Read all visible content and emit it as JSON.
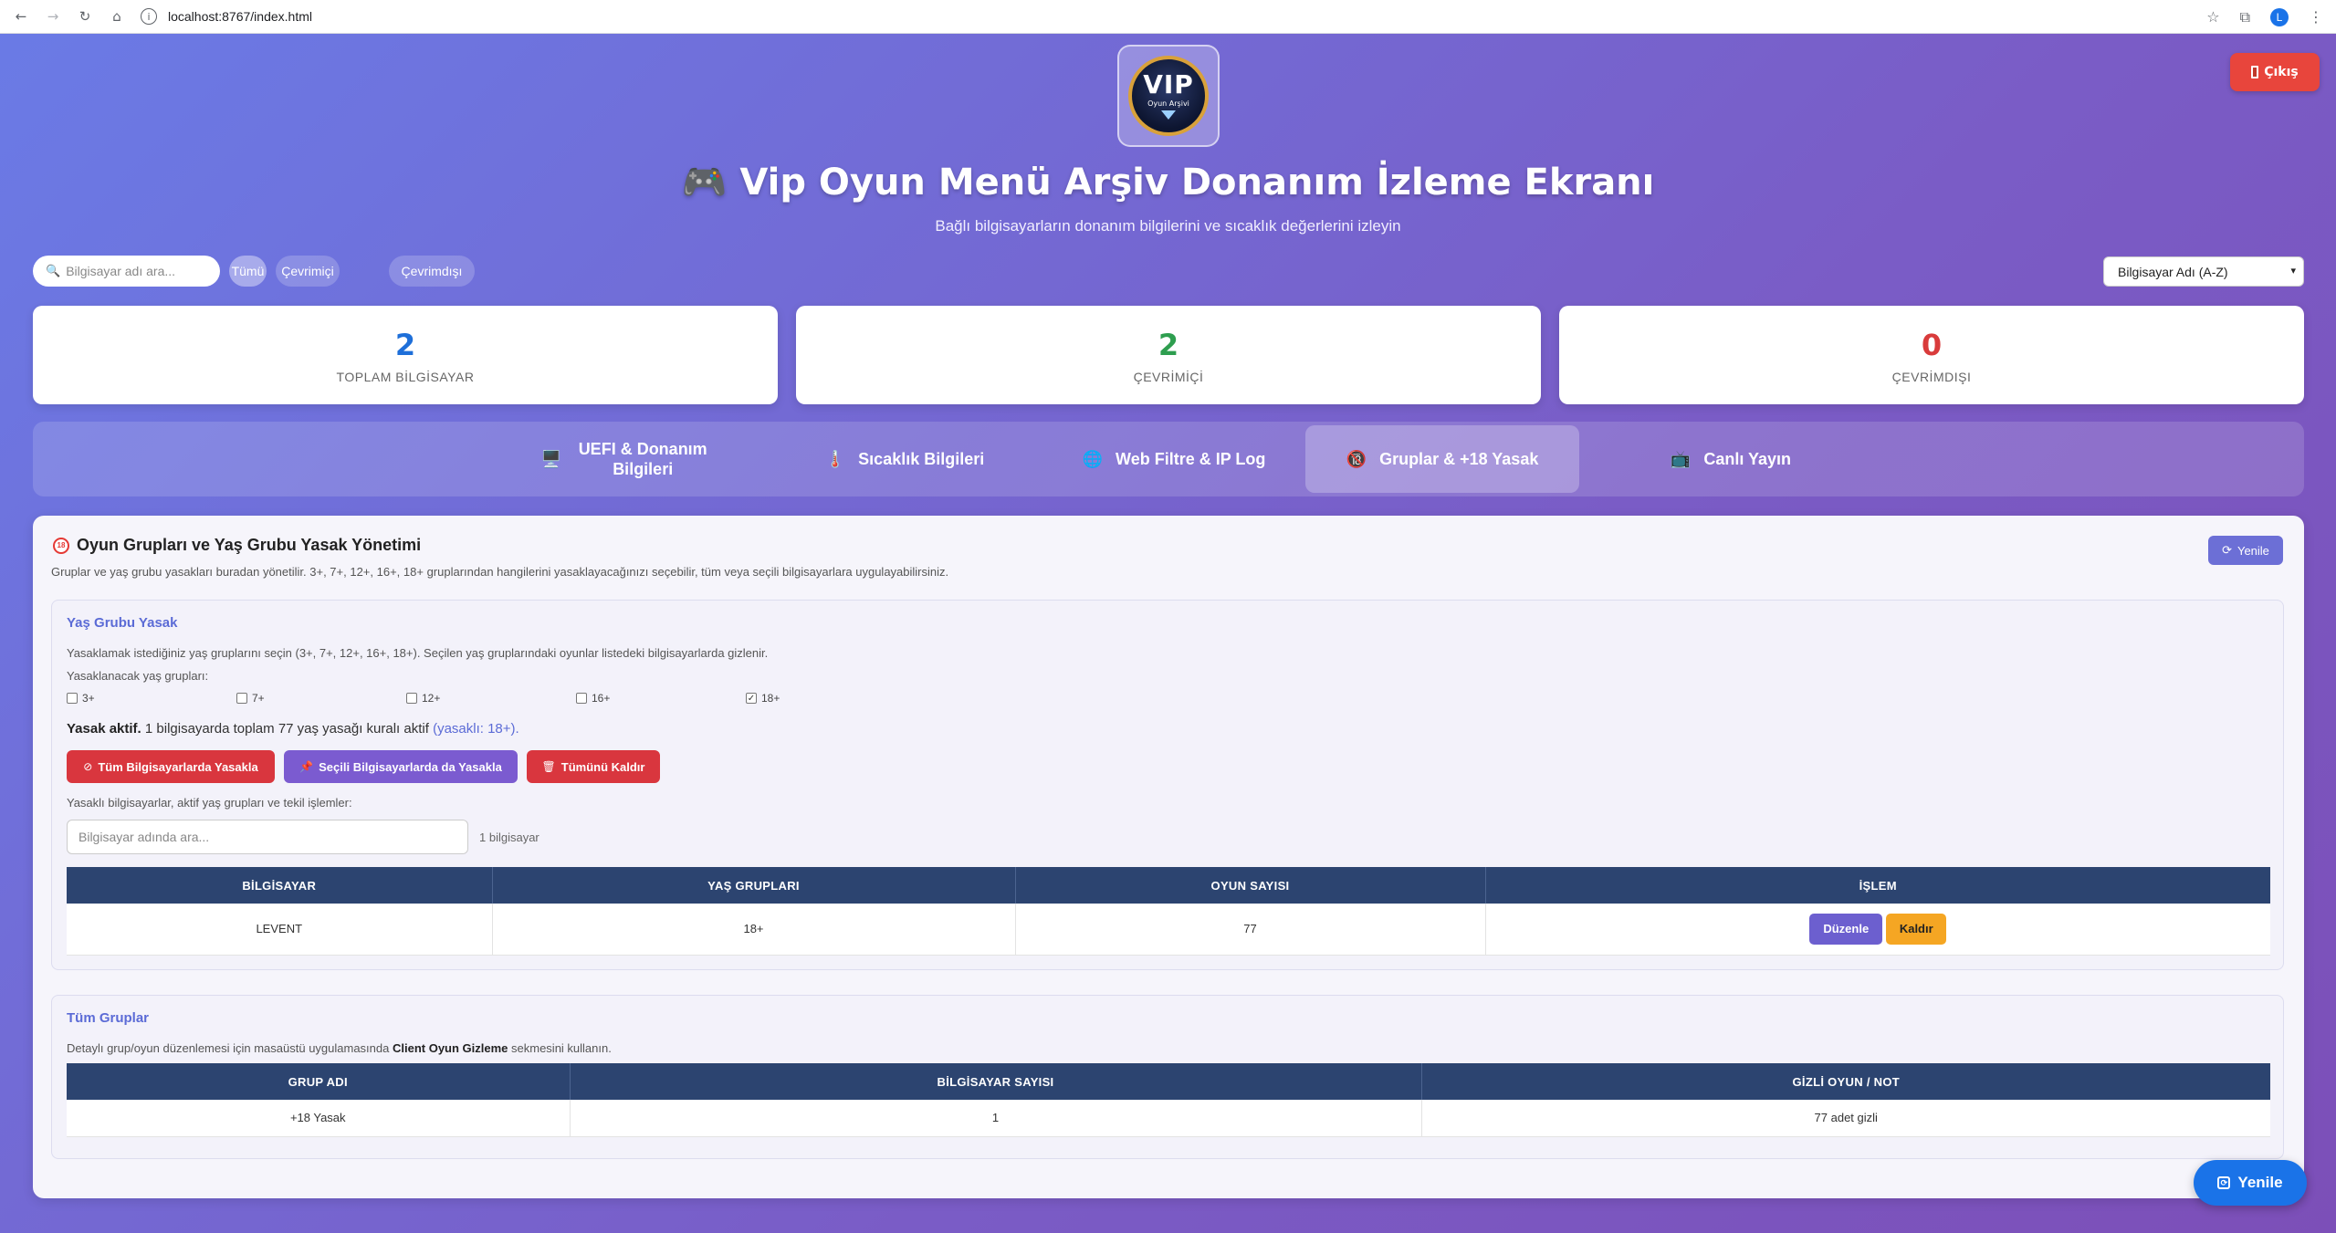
{
  "browser": {
    "url": "localhost:8767/index.html",
    "avatar_letter": "L"
  },
  "logo": {
    "text": "VIP",
    "sub": "Oyun Arşivi"
  },
  "header": {
    "logout_label": "Çıkış",
    "title": "🎮 Vip Oyun Menü Arşiv Donanım İzleme Ekranı",
    "subtitle": "Bağlı bilgisayarların donanım bilgilerini ve sıcaklık değerlerini izleyin"
  },
  "filters": {
    "search_placeholder": "Bilgisayar adı ara...",
    "buttons": [
      "Tümü",
      "Çevrimiçi",
      "Çevrimdışı"
    ],
    "sort_value": "Bilgisayar Adı (A-Z)"
  },
  "stats": [
    {
      "value": "2",
      "label": "TOPLAM BİLGİSAYAR",
      "color": "#1e6fd9"
    },
    {
      "value": "2",
      "label": "ÇEVRİMİÇİ",
      "color": "#2e9e4f"
    },
    {
      "value": "0",
      "label": "ÇEVRİMDIŞI",
      "color": "#d93b3b"
    }
  ],
  "tabs": [
    {
      "label": "UEFI & Donanım Bilgileri",
      "icon": "🖥️"
    },
    {
      "label": "Sıcaklık Bilgileri",
      "icon": "🌡️"
    },
    {
      "label": "Web Filtre & IP Log",
      "icon": "🌐"
    },
    {
      "label": "Gruplar & +18 Yasak",
      "icon": "🔞"
    },
    {
      "label": "Canlı Yayın",
      "icon": "📺"
    }
  ],
  "panel": {
    "title": "Oyun Grupları ve Yaş Grubu Yasak Yönetimi",
    "desc": "Gruplar ve yaş grubu yasakları buradan yönetilir. 3+, 7+, 12+, 16+, 18+ gruplarından hangilerini yasaklayacağınızı seçebilir, tüm veya seçili bilgisayarlara uygulayabilirsiniz.",
    "refresh_label": "Yenile"
  },
  "age_section": {
    "title": "Yaş Grubu Yasak",
    "help": "Yasaklamak istediğiniz yaş gruplarını seçin (3+, 7+, 12+, 16+, 18+). Seçilen yaş gruplarındaki oyunlar listedeki bilgisayarlarda gizlenir.",
    "groups_label": "Yasaklanacak yaş grupları:",
    "groups": [
      {
        "label": "3+",
        "checked": false
      },
      {
        "label": "7+",
        "checked": false
      },
      {
        "label": "12+",
        "checked": false
      },
      {
        "label": "16+",
        "checked": false
      },
      {
        "label": "18+",
        "checked": true
      }
    ],
    "status_bold": "Yasak aktif.",
    "status_text": " 1 bilgisayarda toplam 77 yaş yasağı kuralı aktif ",
    "status_highlight": "(yasaklı: 18+).",
    "buttons": {
      "ban_all": "Tüm Bilgisayarlarda Yasakla",
      "ban_selected": "Seçili Bilgisayarlarda da Yasakla",
      "remove_all": "Tümünü Kaldır"
    },
    "list_label": "Yasaklı bilgisayarlar, aktif yaş grupları ve tekil işlemler:",
    "search_placeholder": "Bilgisayar adında ara...",
    "count": "1 bilgisayar",
    "columns": [
      "BİLGİSAYAR",
      "YAŞ GRUPLARI",
      "OYUN SAYISI",
      "İŞLEM"
    ],
    "rows": [
      {
        "computer": "LEVENT",
        "groups": "18+",
        "games": "77",
        "edit": "Düzenle",
        "remove": "Kaldır"
      }
    ]
  },
  "all_groups": {
    "title": "Tüm Gruplar",
    "help_pre": "Detaylı grup/oyun düzenlemesi için masaüstü uygulamasında ",
    "help_bold": "Client Oyun Gizleme",
    "help_post": " sekmesini kullanın.",
    "columns": [
      "GRUP ADI",
      "BİLGİSAYAR SAYISI",
      "GİZLİ OYUN / NOT"
    ],
    "rows": [
      {
        "name": "+18 Yasak",
        "count": "1",
        "note": "77 adet gizli"
      }
    ]
  },
  "fab": {
    "label": "Yenile"
  }
}
